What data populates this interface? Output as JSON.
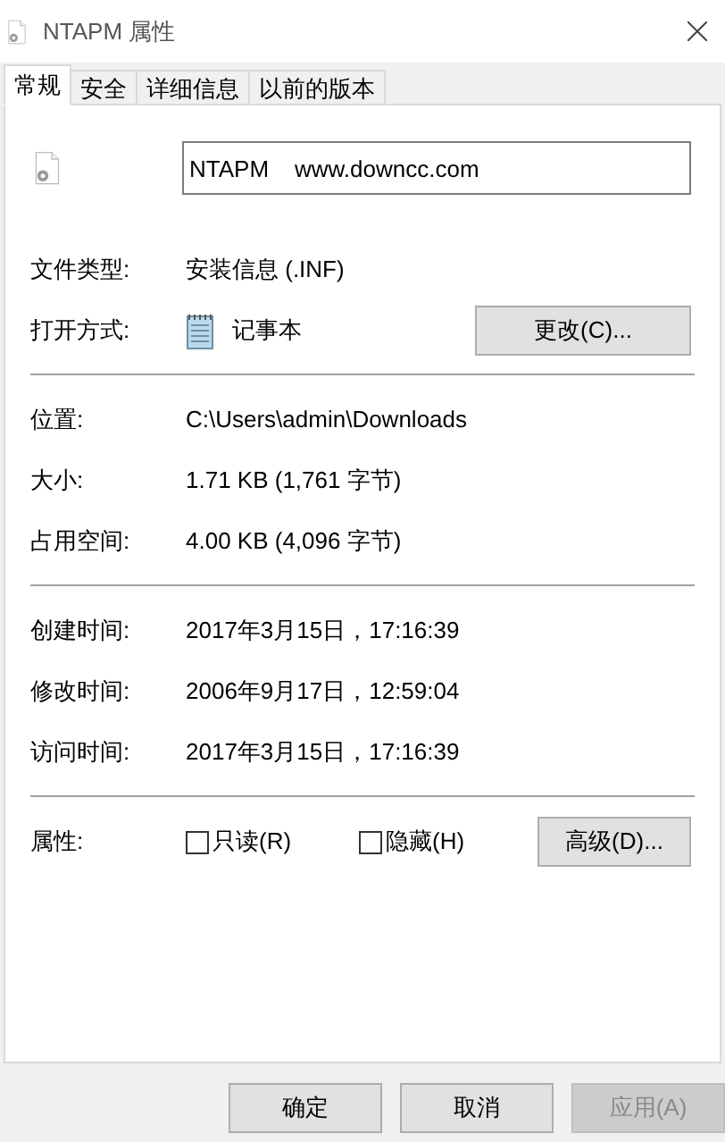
{
  "window": {
    "title": "NTAPM 属性"
  },
  "tabs": [
    {
      "label": "常规",
      "selected": true
    },
    {
      "label": "安全",
      "selected": false
    },
    {
      "label": "详细信息",
      "selected": false
    },
    {
      "label": "以前的版本",
      "selected": false
    }
  ],
  "name_field": {
    "value": "NTAPM    www.downcc.com"
  },
  "sections": [
    {
      "rows": [
        {
          "kind": "text",
          "label": "文件类型:",
          "value": "安装信息 (.INF)"
        },
        {
          "kind": "app",
          "label": "打开方式:",
          "value": "记事本",
          "button": "更改(C)..."
        }
      ]
    },
    {
      "rows": [
        {
          "kind": "text",
          "label": "位置:",
          "value": "C:\\Users\\admin\\Downloads"
        },
        {
          "kind": "text",
          "label": "大小:",
          "value": "1.71 KB (1,761 字节)"
        },
        {
          "kind": "text",
          "label": "占用空间:",
          "value": "4.00 KB (4,096 字节)"
        }
      ]
    },
    {
      "rows": [
        {
          "kind": "text",
          "label": "创建时间:",
          "value": "2017年3月15日，17:16:39"
        },
        {
          "kind": "text",
          "label": "修改时间:",
          "value": "2006年9月17日，12:59:04"
        },
        {
          "kind": "text",
          "label": "访问时间:",
          "value": "2017年3月15日，17:16:39"
        }
      ]
    },
    {
      "rows": [
        {
          "kind": "attributes",
          "label": "属性:",
          "checkboxes": [
            {
              "label": "只读(R)",
              "checked": false
            },
            {
              "label": "隐藏(H)",
              "checked": false
            }
          ],
          "button": "高级(D)..."
        }
      ]
    }
  ],
  "buttons": [
    {
      "label": "确定",
      "disabled": false
    },
    {
      "label": "取消",
      "disabled": false
    },
    {
      "label": "应用(A)",
      "disabled": true
    }
  ]
}
